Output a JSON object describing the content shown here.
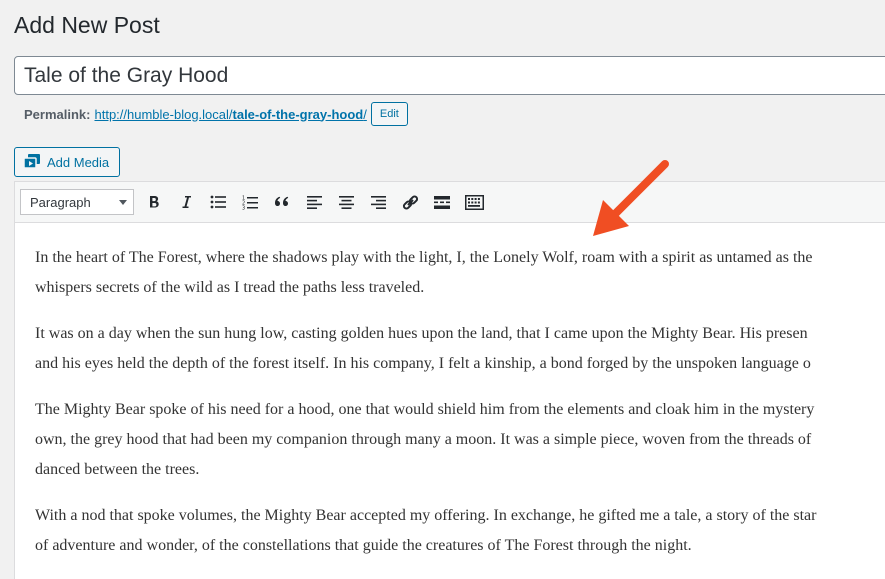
{
  "page": {
    "heading": "Add New Post"
  },
  "post": {
    "title": "Tale of the Gray Hood"
  },
  "permalink": {
    "label": "Permalink:",
    "base": "http://humble-blog.local/",
    "slug": "tale-of-the-gray-hood",
    "trail": "/",
    "edit_label": "Edit"
  },
  "media": {
    "add_label": "Add Media"
  },
  "toolbar": {
    "format_value": "Paragraph",
    "buttons": [
      "bold-icon",
      "italic-icon",
      "bulleted-list-icon",
      "numbered-list-icon",
      "blockquote-icon",
      "align-left-icon",
      "align-center-icon",
      "align-right-icon",
      "link-icon",
      "read-more-icon",
      "toolbar-toggle-icon"
    ]
  },
  "content": {
    "lines": [
      "In the heart of The Forest, where the shadows play with the light, I, the Lonely Wolf, roam with a spirit as untamed as the",
      "whispers secrets of the wild as I tread the paths less traveled.",
      "It was on a day when the sun hung low, casting golden hues upon the land, that I came upon the Mighty Bear. His presen",
      "and his eyes held the depth of the forest itself. In his company, I felt a kinship, a bond forged by the unspoken language o",
      "The Mighty Bear spoke of his need for a hood, one that would shield him from the elements and cloak him in the mystery",
      "own, the grey hood that had been my companion through many a moon. It was a simple piece, woven from the threads of",
      "danced between the trees.",
      "With a nod that spoke volumes, the Mighty Bear accepted my offering. In exchange, he gifted me a tale, a story of the star",
      "of adventure and wonder, of the constellations that guide the creatures of The Forest through the night."
    ]
  },
  "annotation": {
    "arrow_color": "#f04e23"
  }
}
